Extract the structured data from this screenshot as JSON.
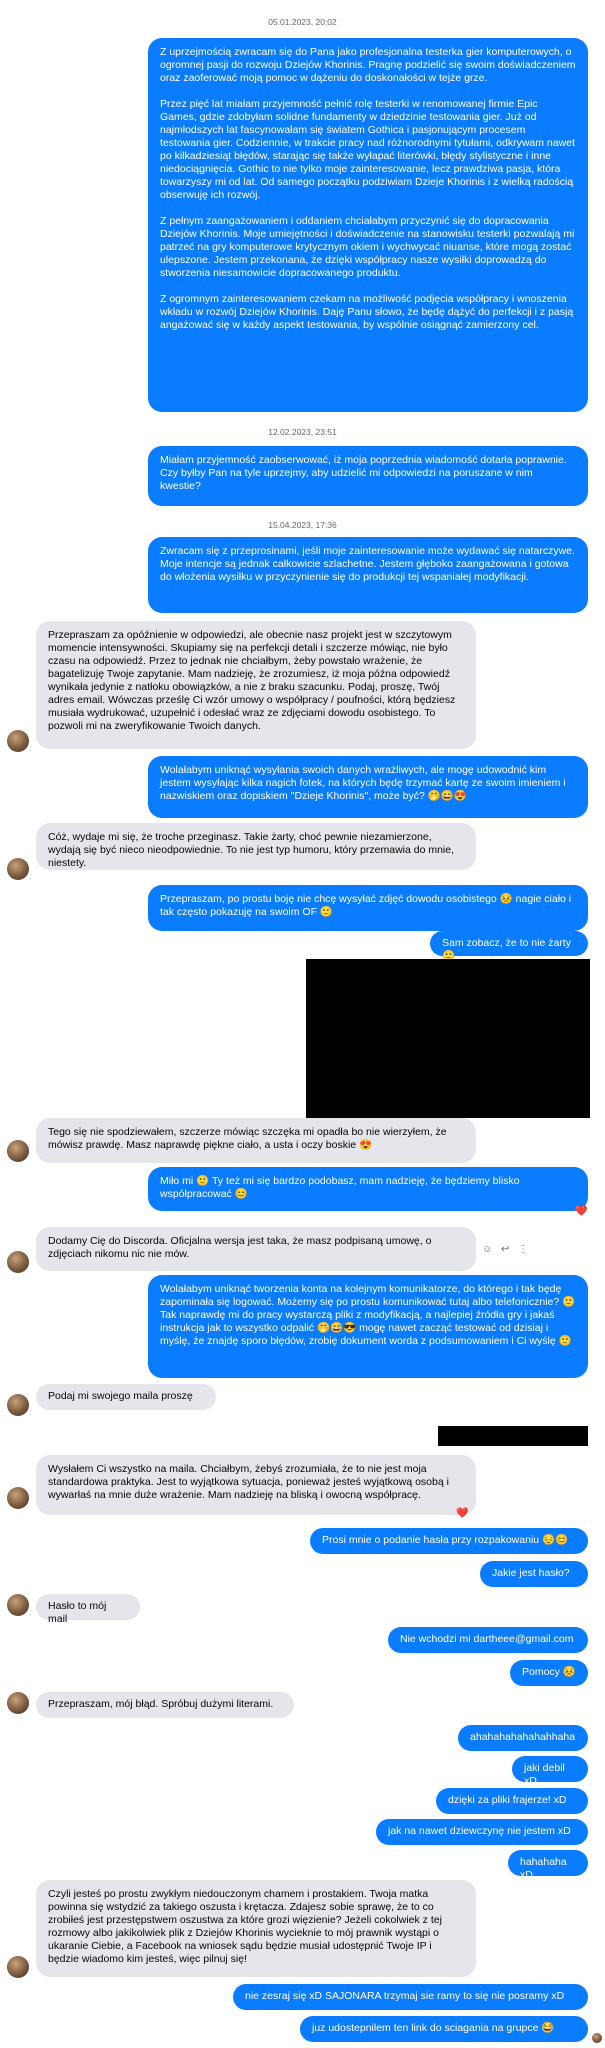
{
  "timestamps": [
    "05.01.2023, 20:02",
    "12.02.2023, 23:51",
    "15.04.2023, 17:36"
  ],
  "messages": [
    {
      "text": "Z uprzejmością zwracam się do Pana jako profesjonalna testerka gier komputerowych, o ogromnej pasji do rozwoju Dziejów Khorinis. Pragnę podzielić się swoim doświadczeniem oraz zaoferować moją pomoc w dążeniu do doskonałości w tejże grze.\n\nPrzez pięć lat miałam przyjemność pełnić rolę testerki w renomowanej firmie Epic Games, gdzie zdobyłam solidne fundamenty w dziedzinie testowania gier. Już od najmłodszych lat fascynowałam się światem Gothica i pasjonującym procesem testowania gier. Codziennie, w trakcie pracy nad różnorodnymi tytułami, odkrywam nawet po kilkadziesiąt błędów, starając się także wyłapać literówki, błędy stylistyczne i inne niedociągnięcia. Gothic to nie tylko moje zainteresowanie, lecz prawdziwa pasja, która towarzyszy mi od lat. Od samego początku podziwiam Dzieje Khorinis i z wielką radością obserwuję ich rozwój.\n\nZ pełnym zaangażowaniem i oddaniem chciałabym przyczynić się do dopracowania Dziejów Khorinis. Moje umiejętności i doświadczenie na stanowisku testerki pozwalają mi patrzeć na gry komputerowe krytycznym okiem i wychwycać niuanse, które mogą zostać ulepszone. Jestem przekonana, że dzięki współpracy nasze wysiłki doprowadzą do stworzenia niesamowicie dopracowanego produktu.\n\nZ ogromnym zainteresowaniem czekam na możliwość podjęcia współpracy i wnoszenia wkładu w rozwój Dziejów Khorinis. Daję Panu słowo, że będę dążyć do perfekcji i z pasją angażować się w każdy aspekt testowania, by wspólnie osiągnąć zamierzony cel."
    },
    {
      "text": "Miałam przyjemność zaobserwować, iż moja poprzednia wiadomość dotarła poprawnie. Czy byłby Pan na tyle uprzejmy, aby udzielić mi odpowiedzi na poruszane w nim kwestie?"
    },
    {
      "text": "Zwracam się z przeprosinami, jeśli moje zainteresowanie może wydawać się natarczywe. Moje intencje są jednak całkowicie szlachetne. Jestem głęboko zaangażowana i gotowa do włożenia wysiłku w przyczynienie się do produkcji tej wspaniałej modyfikacji."
    },
    {
      "text": "Przepraszam za opóźnienie w odpowiedzi, ale obecnie nasz projekt jest w szczytowym momencie intensywności. Skupiamy się na perfekcji detali i szczerze mówiąc, nie było czasu na odpowiedź. Przez to jednak nie chciałbym, żeby powstało wrażenie, że bagatelizuję Twoje zapytanie. Mam nadzieję, że zrozumiesz, iż moja późna odpowiedź wynikała jedynie z natłoku obowiązków, a nie z braku szacunku. Podaj, proszę, Twój adres email. Wówczas prześlę Ci wzór umowy o współpracy / poufności, którą będziesz musiała wydrukować, uzupełnić i odesłać wraz ze zdjęciami dowodu osobistego. To pozwoli mi na zweryfikowanie Twoich danych."
    },
    {
      "text": "Wolałabym uniknąć wysyłania swoich danych wrażliwych, ale mogę udowodnić kim jestem wysyłając kilka nagich fotek, na których będę trzymać kartę ze swoim imieniem i nazwiskiem oraz dopiskiem \"Dzieje Khorinis\", może być? 🤭😅😍"
    },
    {
      "text": "Cóż, wydaje mi się, że troche przeginasz. Takie żarty, choć pewnie niezamierzone, wydają się być nieco nieodpowiednie. To nie jest typ humoru, który przemawia do mnie, niestety."
    },
    {
      "text": "Przepraszam, po prostu boję nie chcę wysyłać zdjęć dowodu osobistego 😣 nagie ciało i tak często pokazuję na swoim OF 🙂"
    },
    {
      "text": "Sam zobacz, że to nie żarty 🙂"
    },
    {
      "text": "Tego się nie spodziewałem, szczerze mówiąc szczęka mi opadła bo nie wierzyłem, że mówisz prawdę. Masz naprawdę piękne ciało, a usta i oczy boskie 😍"
    },
    {
      "text": "Miło mi 🙂 Ty też mi się bardzo podobasz, mam nadzieję, że będziemy blisko współpracować 😊"
    },
    {
      "text": "Dodamy Cię do Discorda. Oficjalna wersja jest taka, że masz podpisaną umowę, o zdjęciach nikomu nic nie mów."
    },
    {
      "text": "Wolałabym uniknąć tworzenia konta na kolejnym komunikatorze, do którego i tak będę zapominała się logować. Możemy się po prostu komunikować tutaj albo telefonicznie? 🙂 Tak naprawdę mi do pracy wystarczą pliki z modyfikacją, a najlepiej źródła gry i jakaś instrukcja jak to wszystko odpalić 🤭😅😎 mogę nawet zacząć testować od dzisiaj i myślę, że znajdę sporo błędów, zrobię dokument worda z podsumowaniem i Ci wyślę 🙂"
    },
    {
      "text": "Podaj mi swojego maila proszę"
    },
    {
      "text": "Wysłałem Ci wszystko na maila. Chciałbym, żebyś zrozumiała, że to nie jest moja standardowa praktyka. Jest to wyjątkowa sytuacja, ponieważ jesteś wyjątkową osobą i wywarłaś na mnie duże wrażenie. Mam nadzieję na bliską i owocną współpracę."
    },
    {
      "text": "Prosi mnie o podanie hasła przy rozpakowaniu 😔😊"
    },
    {
      "text": "Jakie jest hasło?"
    },
    {
      "text": "Hasło to mój mail"
    },
    {
      "text": "Nie wchodzi mi dartheee@gmail.com"
    },
    {
      "text": "Pomocy 😣"
    },
    {
      "text": "Przepraszam, mój błąd. Spróbuj dużymi literami."
    },
    {
      "text": "ahahahahahahahhaha"
    },
    {
      "text": "jaki debil xD"
    },
    {
      "text": "dzięki za pliki frajerze! xD"
    },
    {
      "text": "jak na nawet dziewczynę nie jestem xD"
    },
    {
      "text": "hahahaha xD"
    },
    {
      "text": "Czyli jesteś po prostu zwykłym niedouczonym chamem i prostakiem. Twoja matka powinna się wstydzić za takiego oszusta i krętacza. Zdajesz sobie sprawę, że to co zrobiłeś jest przestępstwem oszustwa za które grozi więzienie? Jeżeli cokolwiek z tej rozmowy albo jakikolwiek plik z Dziejów Khorinis wycieknie to mój prawnik wystąpi o ukaranie Ciebie, a Facebook na wniosek sądu będzie musiał udostępnić Twoje IP i będzie wiadomo kim jesteś, więc pilnuj się!"
    },
    {
      "text": "nie zesraj się xD SAJONARA trzymaj sie ramy to się nie posramy xD"
    },
    {
      "text": "juz udostepnilem ten link do sciagania na grupce 😂"
    }
  ],
  "reactions": {
    "heart": "❤️"
  },
  "actions": {
    "emoji": "☺",
    "reply": "↩",
    "more": "⋮"
  }
}
